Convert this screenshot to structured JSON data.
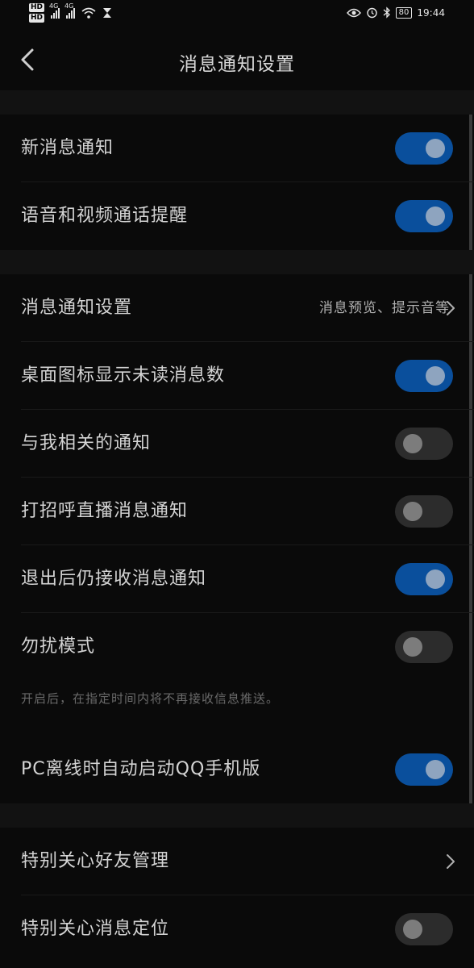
{
  "status_bar": {
    "hd1": "HD",
    "hd2": "HD",
    "net1": "4G",
    "net2": "4G",
    "battery": "80",
    "time": "19:44",
    "icons": [
      "signal-icon",
      "signal-icon",
      "wifi-icon",
      "hourglass-icon",
      "eye-icon",
      "alarm-icon",
      "bluetooth-icon",
      "battery-icon"
    ]
  },
  "header": {
    "title": "消息通知设置",
    "back_icon": "chevron-left-icon"
  },
  "colors": {
    "toggle_on": "#0a4f9c",
    "toggle_off": "#2c2c2c",
    "background": "#0a0a0a",
    "separator": "#121212"
  },
  "items": [
    {
      "label": "新消息通知",
      "type": "toggle",
      "on": true
    },
    {
      "label": "语音和视频通话提醒",
      "type": "toggle",
      "on": true
    },
    {
      "label": "消息通知设置",
      "type": "link",
      "value": "消息预览、提示音等"
    },
    {
      "label": "桌面图标显示未读消息数",
      "type": "toggle",
      "on": true
    },
    {
      "label": "与我相关的通知",
      "type": "toggle",
      "on": false
    },
    {
      "label": "打招呼直播消息通知",
      "type": "toggle",
      "on": false
    },
    {
      "label": "退出后仍接收消息通知",
      "type": "toggle",
      "on": true
    },
    {
      "label": "勿扰模式",
      "type": "toggle",
      "on": false
    },
    {
      "label": "PC离线时自动启动QQ手机版",
      "type": "toggle",
      "on": true
    },
    {
      "label": "特别关心好友管理",
      "type": "link"
    },
    {
      "label": "特别关心消息定位",
      "type": "toggle",
      "on": false
    }
  ],
  "dnd_note": "开启后，在指定时间内将不再接收信息推送。"
}
